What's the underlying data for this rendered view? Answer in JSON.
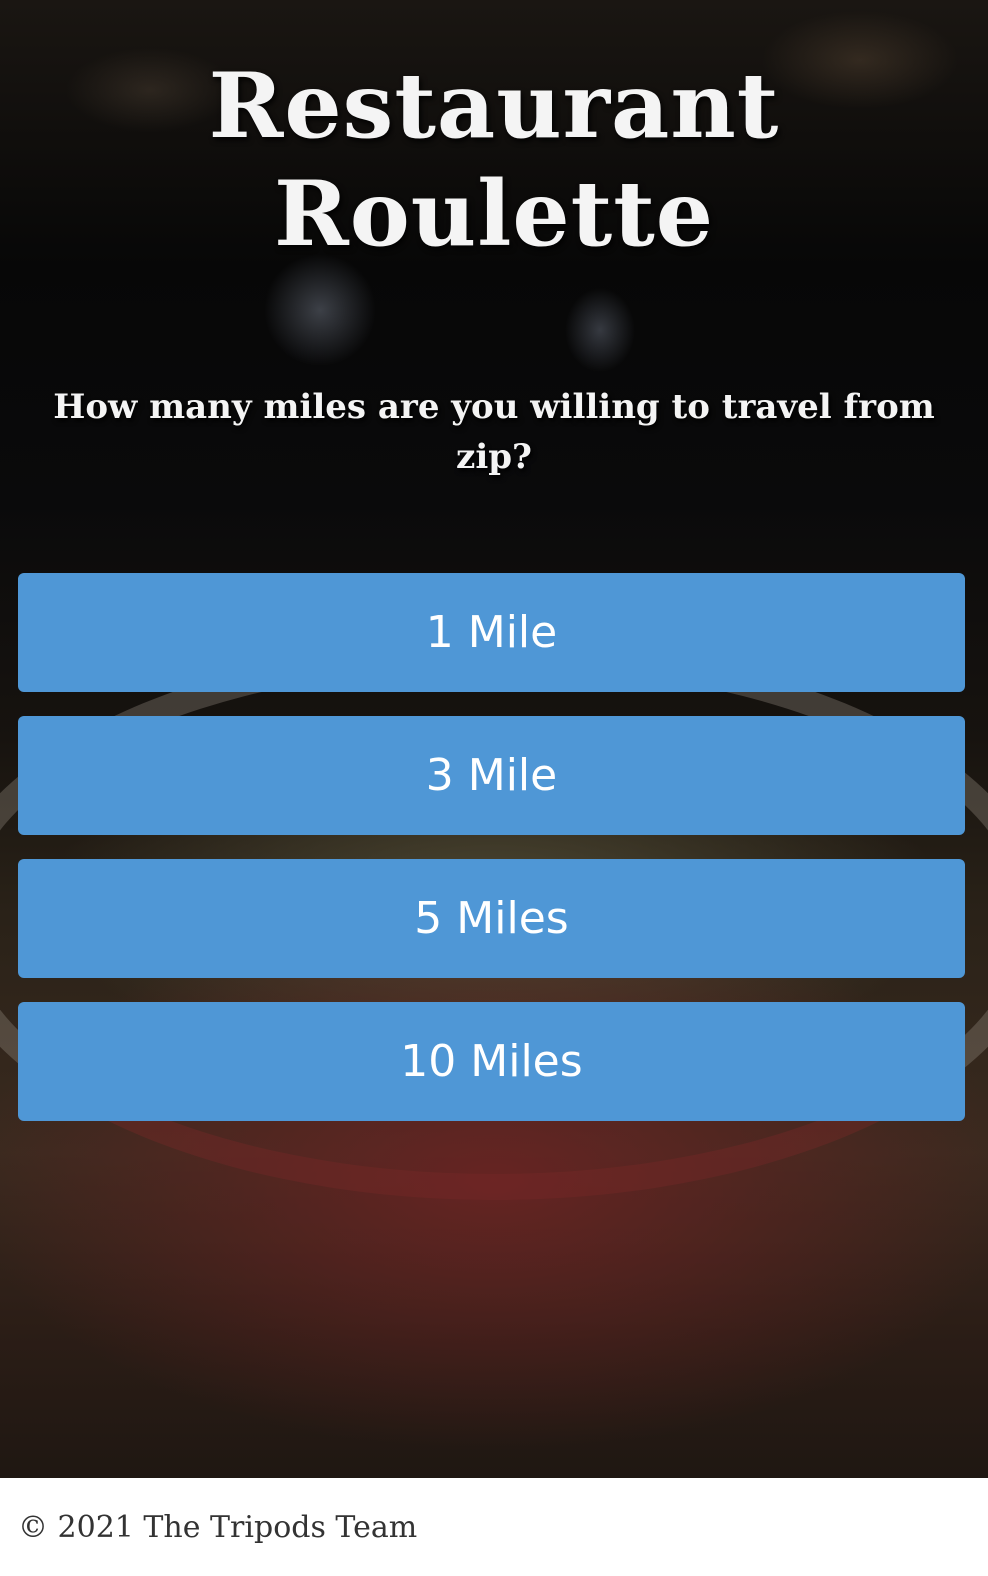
{
  "header": {
    "title_line1": "Restaurant",
    "title_line2": "Roulette"
  },
  "question": {
    "text": "How many miles are you willing to travel from zip?"
  },
  "options": [
    {
      "label": "1 Mile"
    },
    {
      "label": "3 Mile"
    },
    {
      "label": "5 Miles"
    },
    {
      "label": "10 Miles"
    }
  ],
  "footer": {
    "copyright": "© 2021 The Tripods Team"
  },
  "colors": {
    "button_bg": "#4f97d6",
    "button_text": "#ffffff",
    "heading_text": "#f4f4f4",
    "footer_text": "#333333"
  }
}
